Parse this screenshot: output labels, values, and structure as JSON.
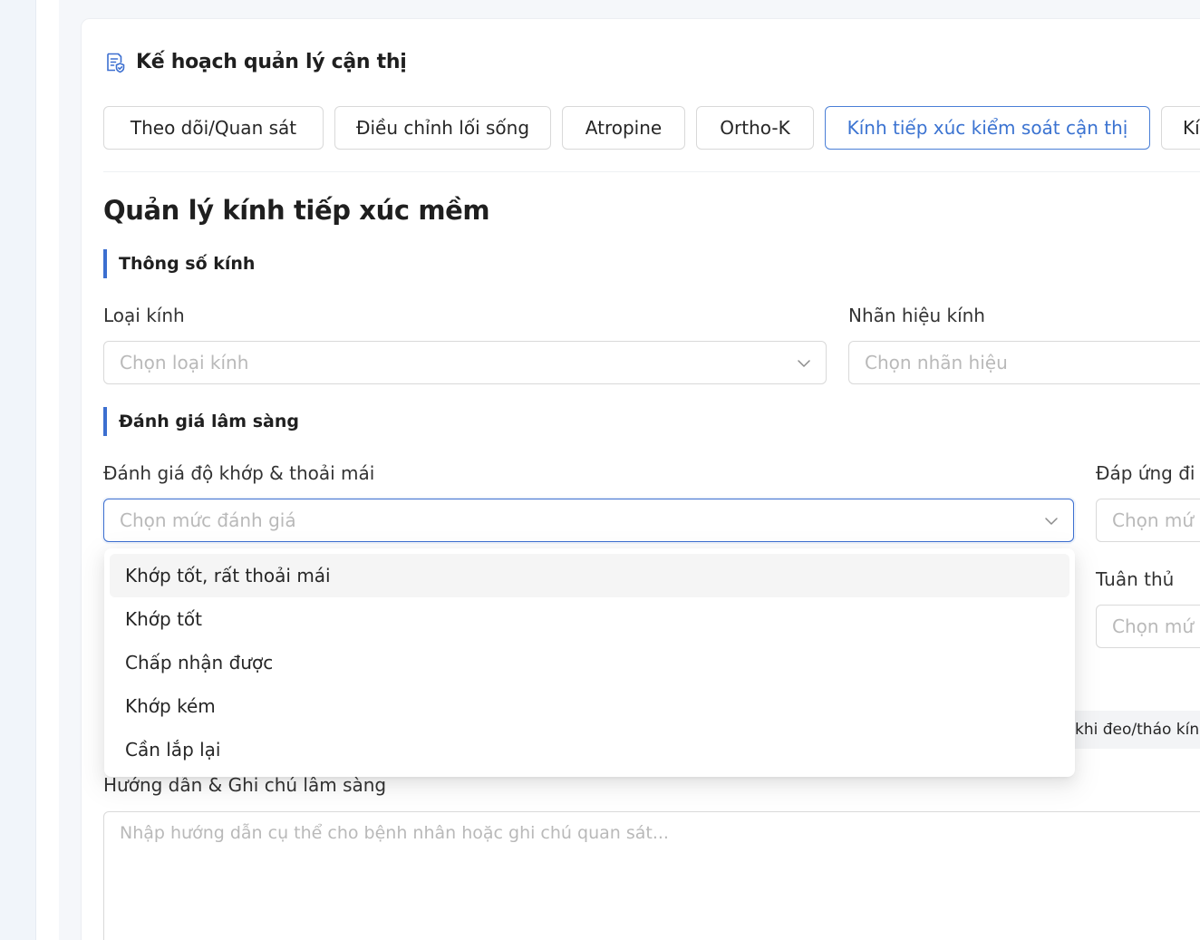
{
  "plan": {
    "title": "Kế hoạch quản lý cận thị",
    "tabs": [
      {
        "label": "Theo dõi/Quan sát",
        "active": false
      },
      {
        "label": "Điều chỉnh lối sống",
        "active": false
      },
      {
        "label": "Atropine",
        "active": false
      },
      {
        "label": "Ortho-K",
        "active": false
      },
      {
        "label": "Kính tiếp xúc kiểm soát cận thị",
        "active": true
      },
      {
        "label": "Kí",
        "active": false
      }
    ]
  },
  "section": {
    "title": "Quản lý kính tiếp xúc mềm"
  },
  "lens_specs": {
    "heading": "Thông số kính",
    "lens_type": {
      "label": "Loại kính",
      "placeholder": "Chọn loại kính"
    },
    "lens_brand": {
      "label": "Nhãn hiệu kính",
      "placeholder": "Chọn nhãn hiệu"
    }
  },
  "clinical": {
    "heading": "Đánh giá lâm sàng",
    "fit": {
      "label": "Đánh giá độ khớp & thoải mái",
      "placeholder": "Chọn mức đánh giá"
    },
    "response": {
      "label": "Đáp ứng đi",
      "placeholder": "Chọn mứ"
    },
    "compliance": {
      "label": "Tuân thủ",
      "placeholder": "Chọn mứ"
    },
    "chip": "khi đeo/tháo kín"
  },
  "dropdown": {
    "options": [
      "Khớp tốt, rất thoải mái",
      "Khớp tốt",
      "Chấp nhận được",
      "Khớp kém",
      "Cần lắp lại"
    ],
    "hovered_index": 0
  },
  "notes": {
    "label": "Hướng dẫn & Ghi chú lâm sàng",
    "placeholder": "Nhập hướng dẫn cụ thể cho bệnh nhân hoặc ghi chú quan sát..."
  },
  "colors": {
    "accent": "#3c6fd0",
    "border": "#d9d9d9",
    "placeholder": "#b9b9b9"
  }
}
